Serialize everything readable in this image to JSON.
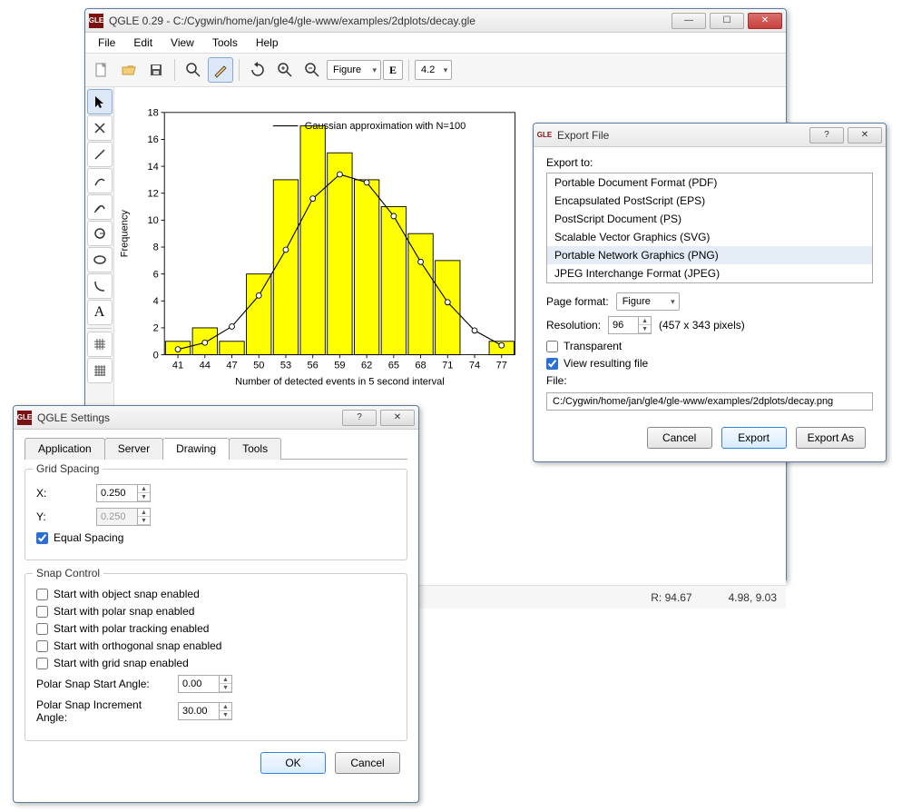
{
  "main": {
    "title": "QGLE 0.29 - C:/Cygwin/home/jan/gle4/gle-www/examples/2dplots/decay.gle",
    "menus": [
      "File",
      "Edit",
      "View",
      "Tools",
      "Help"
    ],
    "figure_select": "Figure",
    "zoom_select": "4.2",
    "status_r": "R:   94.67",
    "status_coord": "4.98, 9.03"
  },
  "chart_data": {
    "type": "bar+line",
    "title": "",
    "xlabel": "Number of detected events in 5 second interval",
    "ylabel": "Frequency",
    "legend": "Gaussian approximation with N=100",
    "categories": [
      41,
      44,
      47,
      50,
      53,
      56,
      59,
      62,
      65,
      68,
      71,
      74,
      77
    ],
    "bars": [
      1,
      2,
      1,
      6,
      13,
      17,
      15,
      13,
      11,
      9,
      7,
      0,
      1
    ],
    "curve": [
      0.4,
      0.9,
      2.1,
      4.4,
      7.8,
      11.6,
      13.4,
      12.8,
      10.3,
      6.9,
      3.9,
      1.8,
      0.7
    ],
    "ylim": [
      0,
      18
    ],
    "xlim": [
      41,
      77
    ]
  },
  "settings": {
    "title": "QGLE Settings",
    "tabs": [
      "Application",
      "Server",
      "Drawing",
      "Tools"
    ],
    "active_tab": "Drawing",
    "grid_spacing_label": "Grid Spacing",
    "x_label": "X:",
    "y_label": "Y:",
    "x_val": "0.250",
    "y_val": "0.250",
    "equal_label": "Equal Spacing",
    "snap_label": "Snap Control",
    "opt1": "Start with object snap enabled",
    "opt2": "Start with polar snap enabled",
    "opt3": "Start with polar tracking enabled",
    "opt4": "Start with orthogonal snap enabled",
    "opt5": "Start with grid snap enabled",
    "polar_start_label": "Polar Snap Start Angle:",
    "polar_start_val": "0.00",
    "polar_inc_label": "Polar Snap Increment Angle:",
    "polar_inc_val": "30.00",
    "ok": "OK",
    "cancel": "Cancel"
  },
  "export": {
    "title": "Export File",
    "export_to": "Export to:",
    "formats": [
      "Portable Document Format (PDF)",
      "Encapsulated PostScript (EPS)",
      "PostScript Document (PS)",
      "Scalable Vector Graphics (SVG)",
      "Portable Network Graphics (PNG)",
      "JPEG Interchange Format (JPEG)"
    ],
    "selected_idx": 4,
    "page_format_label": "Page format:",
    "page_format": "Figure",
    "resolution_label": "Resolution:",
    "resolution": "96",
    "resolution_note": "(457 x 343 pixels)",
    "transparent": "Transparent",
    "view_resulting": "View resulting file",
    "file_label": "File:",
    "file_path": "C:/Cygwin/home/jan/gle4/gle-www/examples/2dplots/decay.png",
    "cancel": "Cancel",
    "export_btn": "Export",
    "export_as": "Export As"
  }
}
